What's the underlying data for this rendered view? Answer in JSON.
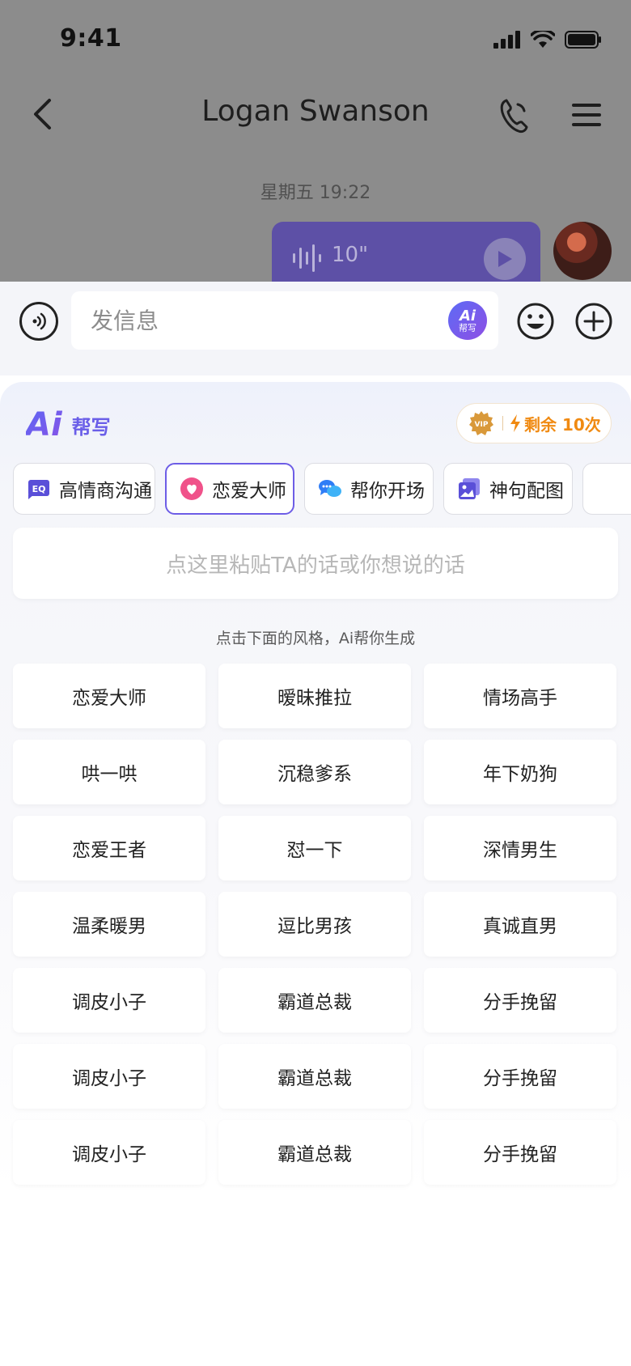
{
  "status_bar": {
    "time": "9:41"
  },
  "header": {
    "title": "Logan Swanson"
  },
  "chat": {
    "timestamp": "星期五 19:22",
    "voice_duration": "10\""
  },
  "input": {
    "placeholder": "发信息",
    "ai_badge_top": "Ai",
    "ai_badge_bottom": "帮写"
  },
  "ai_panel": {
    "logo_mark": "Ai",
    "logo_text": "帮写",
    "vip_label": "VIP",
    "remaining": "剩余 10次",
    "tabs": [
      {
        "label": "高情商沟通",
        "icon": "eq-icon"
      },
      {
        "label": "恋爱大师",
        "icon": "heart-icon",
        "active": true
      },
      {
        "label": "帮你开场",
        "icon": "chat-bubbles-icon"
      },
      {
        "label": "神句配图",
        "icon": "picture-icon"
      }
    ],
    "paste_placeholder": "点这里粘贴TA的话或你想说的话",
    "hint": "点击下面的风格，Ai帮你生成",
    "styles": [
      "恋爱大师",
      "暧昧推拉",
      "情场高手",
      "哄一哄",
      "沉稳爹系",
      "年下奶狗",
      "恋爱王者",
      "怼一下",
      "深情男生",
      "温柔暖男",
      "逗比男孩",
      "真诚直男",
      "调皮小子",
      "霸道总裁",
      "分手挽留",
      "调皮小子",
      "霸道总裁",
      "分手挽留",
      "调皮小子",
      "霸道总裁",
      "分手挽留"
    ]
  },
  "colors": {
    "accent": "#6d5de6",
    "overlay": "#8c8c8c",
    "vip_orange": "#f08a12"
  }
}
